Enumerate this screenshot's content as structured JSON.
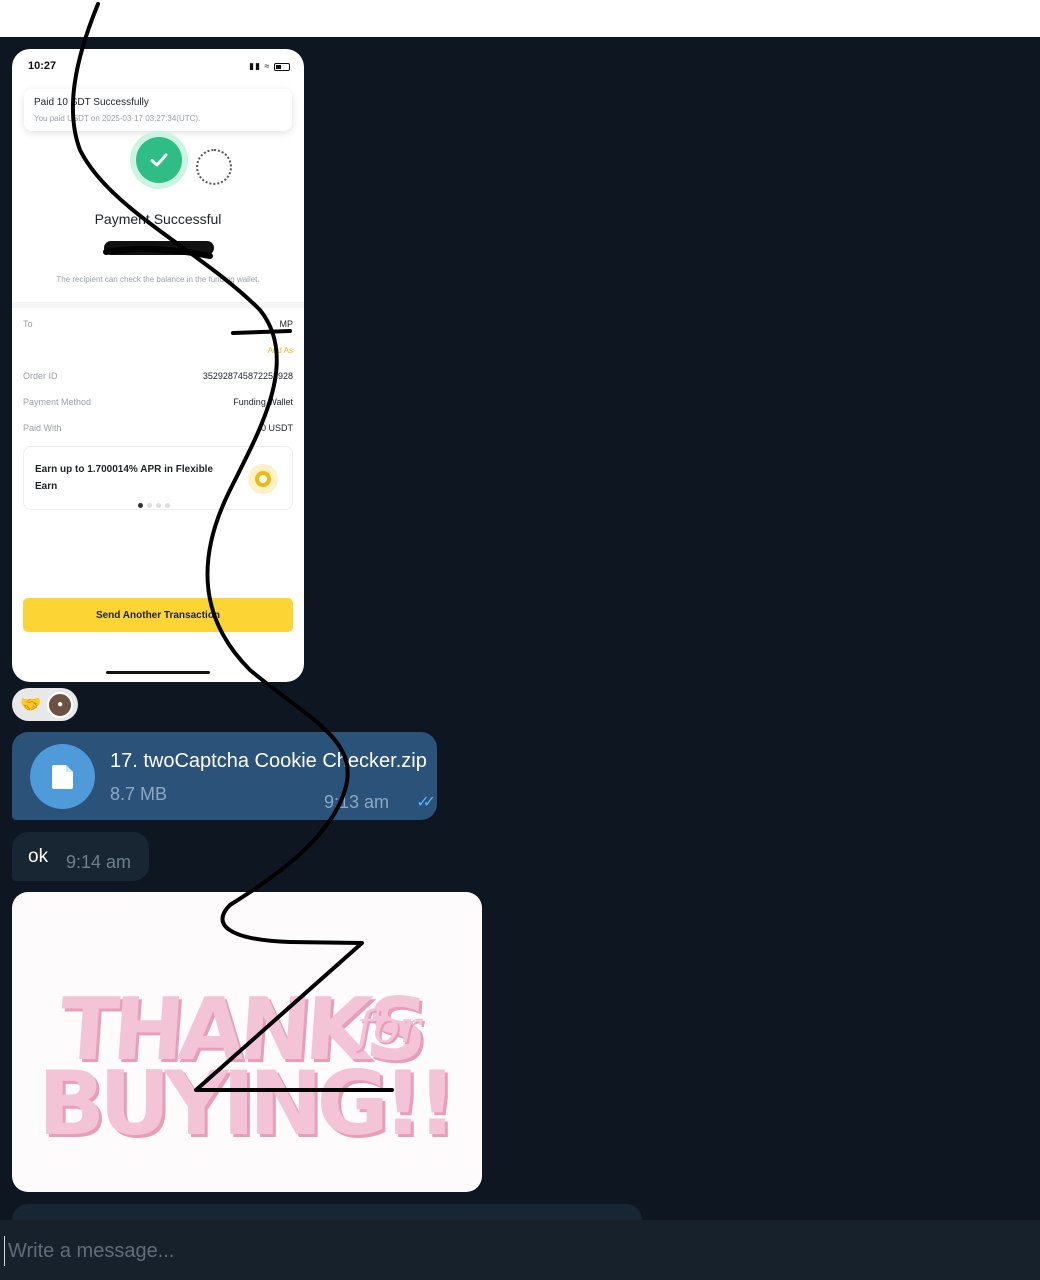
{
  "colors": {
    "background": "#0e1621",
    "outgoing_bubble": "#2b5278",
    "incoming_bubble": "#182533",
    "binance_yellow": "#fcd535",
    "success_green": "#2ebd85"
  },
  "screenshot": {
    "status_time": "10:27",
    "toast_title": "Paid 10 SDT Successfully",
    "toast_subtitle": "You paid USDT on 2025-03-17 03:27:34(UTC).",
    "title": "Payment Successful",
    "note": "The recipient can check the balance in the funding wallet.",
    "to_label": "To",
    "to_value": "MP",
    "add_label": "Add As",
    "order_id_label": "Order ID",
    "order_id_value": "352928745872252928",
    "payment_method_label": "Payment Method",
    "payment_method_value": "Funding Wallet",
    "paid_with_label": "Paid With",
    "paid_with_value": "0 USDT",
    "earn_text": "Earn up to 1.700014% APR in Flexible Earn",
    "button_label": "Send Another Transaction"
  },
  "reaction": {
    "emoji": "🤝"
  },
  "file_message": {
    "name": "17. twoCaptcha Cookie Checker.zip",
    "size": "8.7 MB",
    "time": "9:13 am",
    "icon": "file-icon"
  },
  "text_message": {
    "text": "ok",
    "time": "9:14 am"
  },
  "sticker": {
    "line1": "THANKS",
    "for": "for",
    "line2": "BUYING!!"
  },
  "composer": {
    "placeholder": "Write a message..."
  }
}
